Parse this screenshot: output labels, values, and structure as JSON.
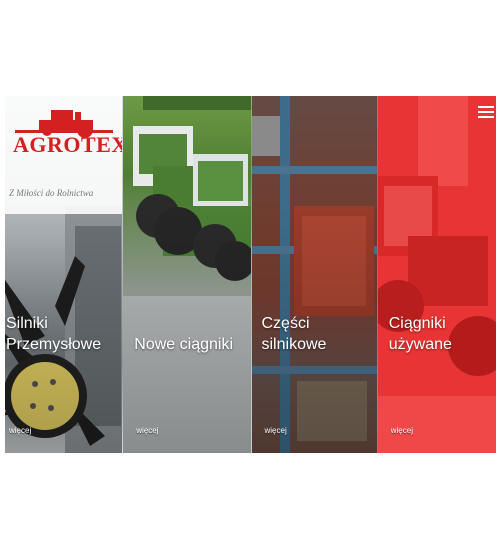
{
  "brand": {
    "name": "AGROTEX",
    "tagline": "Z Miłości do Rolnictwa"
  },
  "panels": [
    {
      "title_line1": "Silniki",
      "title_line2": "Przemysłowe",
      "more": "więcej"
    },
    {
      "title_line1": "Nowe ciągniki",
      "title_line2": "",
      "more": "więcej"
    },
    {
      "title_line1": "Części",
      "title_line2": "silnikowe",
      "more": "więcej"
    },
    {
      "title_line1": "Ciągniki",
      "title_line2": "używane",
      "more": "więcej"
    }
  ],
  "colors": {
    "brand_red": "#d42020",
    "used_tractors_overlay": "#e53030",
    "new_tractors_green": "#4f7d33"
  },
  "icons": {
    "menu": "hamburger-menu-icon",
    "logo": "tractor-logo-icon"
  }
}
